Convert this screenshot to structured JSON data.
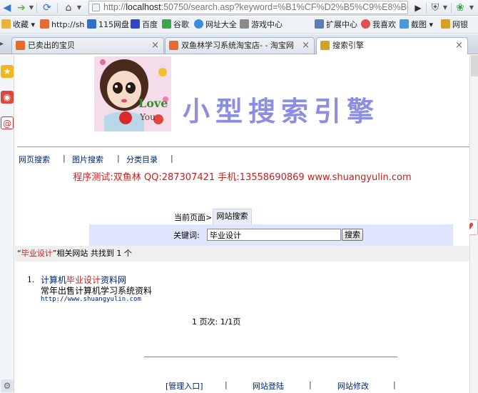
{
  "browser": {
    "url_prefix": "http://",
    "url_host": "localhost",
    "url_rest": ":50750/search.asp?keyword=%B1%CF%D2%B5%C9%E8%BC",
    "favorites": [
      {
        "label": "收藏",
        "color": "#e8b43a"
      },
      {
        "label": "http://sh",
        "color": "#e86b2d"
      },
      {
        "label": "115网盘",
        "color": "#2f6fd0"
      },
      {
        "label": "百度",
        "color": "#2f45c8"
      },
      {
        "label": "谷歌",
        "color": "#3aa74a"
      },
      {
        "label": "网址大全",
        "color": "#3b8de0"
      },
      {
        "label": "游戏中心",
        "color": "#8a8a8a"
      },
      {
        "label": "扩展中心",
        "color": "#5a7fb8"
      },
      {
        "label": "我喜欢",
        "color": "#e05050"
      },
      {
        "label": "截图",
        "color": "#4a9ad8"
      },
      {
        "label": "网银",
        "color": "#d8a020"
      }
    ],
    "tabs": [
      {
        "label": "已卖出的宝贝",
        "color": "#e86b2d",
        "close": "×"
      },
      {
        "label": "双鱼林学习系统淘宝店- - 淘宝网",
        "color": "#e86b2d",
        "close": "×"
      },
      {
        "label": "搜索引擎",
        "color": "#d8a020",
        "close": "×"
      }
    ]
  },
  "header": {
    "site_title": "小型搜索引擎",
    "logo_word": "Love",
    "logo_word2": "You"
  },
  "nav": {
    "web_search": "网页搜索",
    "image_search": "图片搜索",
    "category": "分类目录",
    "separator": "|"
  },
  "contact": "程序测试:双鱼林 QQ:287307421 手机:13558690869 www.shuangyulin.com",
  "breadcrumb": {
    "prefix": "当前页面>>",
    "current": "网站搜索"
  },
  "search": {
    "label": "关键词:",
    "value": "毕业设计",
    "button": "搜索"
  },
  "result_summary": {
    "open_quote": "“",
    "keyword": "毕业设计",
    "rest": "”相关网站 共找到 1 个"
  },
  "results": [
    {
      "num": "1.",
      "title_pre": "计算机",
      "title_hl": "毕业设计",
      "title_post": "资料网",
      "desc": "常年出售计算机学习系统资料",
      "url": "http://www.shuangyulin.com"
    }
  ],
  "pager": "1 页次: 1/1页",
  "footer": {
    "admin": "[管理入口]",
    "login": "网站登陆",
    "modify": "网站修改",
    "separator": "|"
  },
  "colors": {
    "highlight": "#cc1d1d",
    "link": "#00246f",
    "search_panel": "#e0e4fd",
    "title": "#8c8ee0"
  }
}
